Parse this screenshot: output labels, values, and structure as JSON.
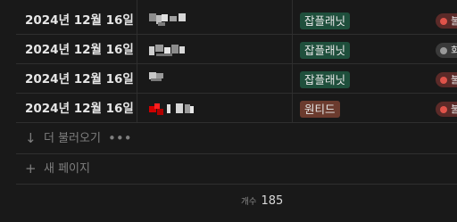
{
  "rows": [
    {
      "date": "2024년 12월 16일",
      "tag": "잡플래닛",
      "tag_color": "#1f4f3c",
      "status": "불",
      "status_color": "#5b2a28",
      "dot_color": "#e0534a"
    },
    {
      "date": "2024년 12월 16일",
      "tag": "잡플래닛",
      "tag_color": "#1f4f3c",
      "status": "회",
      "status_color": "#3a3a3a",
      "dot_color": "#9a9a9a"
    },
    {
      "date": "2024년 12월 16일",
      "tag": "잡플래닛",
      "tag_color": "#1f4f3c",
      "status": "불",
      "status_color": "#5b2a28",
      "dot_color": "#e0534a"
    },
    {
      "date": "2024년 12월 16일",
      "tag": "원티드",
      "tag_color": "#6b3b2e",
      "status": "불",
      "status_color": "#5b2a28",
      "dot_color": "#e0534a"
    }
  ],
  "load_more": {
    "label": "더 불러오기",
    "arrow_icon": "arrow-down-icon",
    "more_icon": "more-icon"
  },
  "new_page": {
    "label": "새 페이지",
    "icon": "plus-icon"
  },
  "summary": {
    "label": "개수",
    "value": "185"
  }
}
